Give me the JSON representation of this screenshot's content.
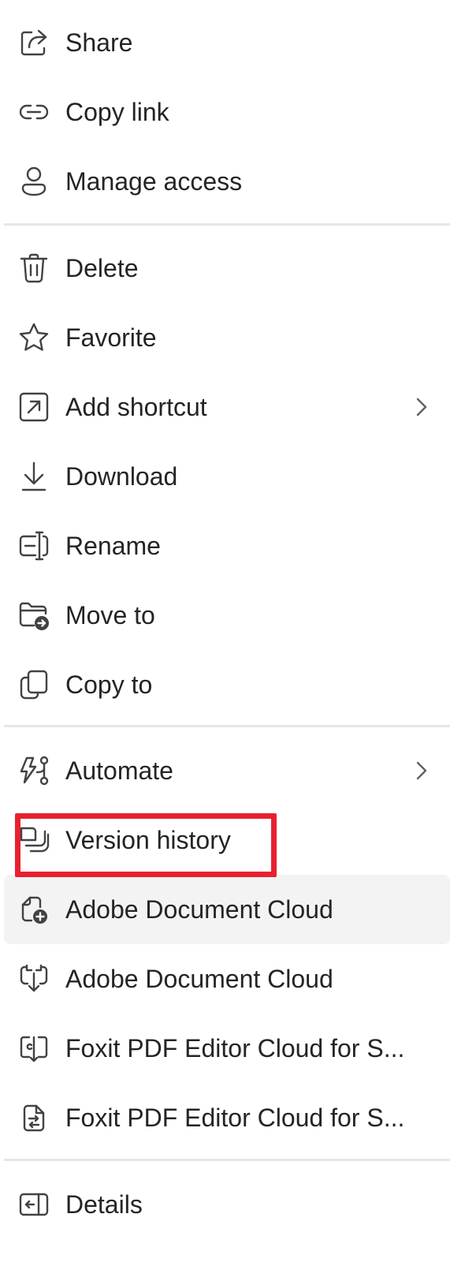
{
  "menu": {
    "items": [
      {
        "id": "share",
        "label": "Share",
        "icon": "share-icon"
      },
      {
        "id": "copy-link",
        "label": "Copy link",
        "icon": "link-icon"
      },
      {
        "id": "manage-access",
        "label": "Manage access",
        "icon": "person-icon"
      },
      {
        "id": "delete",
        "label": "Delete",
        "icon": "trash-icon"
      },
      {
        "id": "favorite",
        "label": "Favorite",
        "icon": "star-icon"
      },
      {
        "id": "add-shortcut",
        "label": "Add shortcut",
        "icon": "shortcut-icon",
        "submenu": true
      },
      {
        "id": "download",
        "label": "Download",
        "icon": "download-icon"
      },
      {
        "id": "rename",
        "label": "Rename",
        "icon": "rename-icon"
      },
      {
        "id": "move-to",
        "label": "Move to",
        "icon": "folder-move-icon"
      },
      {
        "id": "copy-to",
        "label": "Copy to",
        "icon": "copy-icon"
      },
      {
        "id": "automate",
        "label": "Automate",
        "icon": "automate-icon",
        "submenu": true
      },
      {
        "id": "version-history",
        "label": "Version history",
        "icon": "version-history-icon",
        "highlighted": true
      },
      {
        "id": "adobe-document-cloud-1",
        "label": "Adobe Document Cloud",
        "icon": "document-add-icon",
        "hovered": true
      },
      {
        "id": "adobe-document-cloud-2",
        "label": "Adobe Document Cloud",
        "icon": "document-sync-icon"
      },
      {
        "id": "foxit-1",
        "label": "Foxit PDF Editor Cloud for S...",
        "icon": "pdf-edit-icon"
      },
      {
        "id": "foxit-2",
        "label": "Foxit PDF Editor Cloud for S...",
        "icon": "document-convert-icon"
      },
      {
        "id": "details",
        "label": "Details",
        "icon": "details-pane-icon"
      }
    ]
  },
  "colors": {
    "text": "#242424",
    "icon": "#424242",
    "divider": "#e6e6e6",
    "hover_background": "#f3f3f3",
    "highlight_border": "#e8212f"
  }
}
